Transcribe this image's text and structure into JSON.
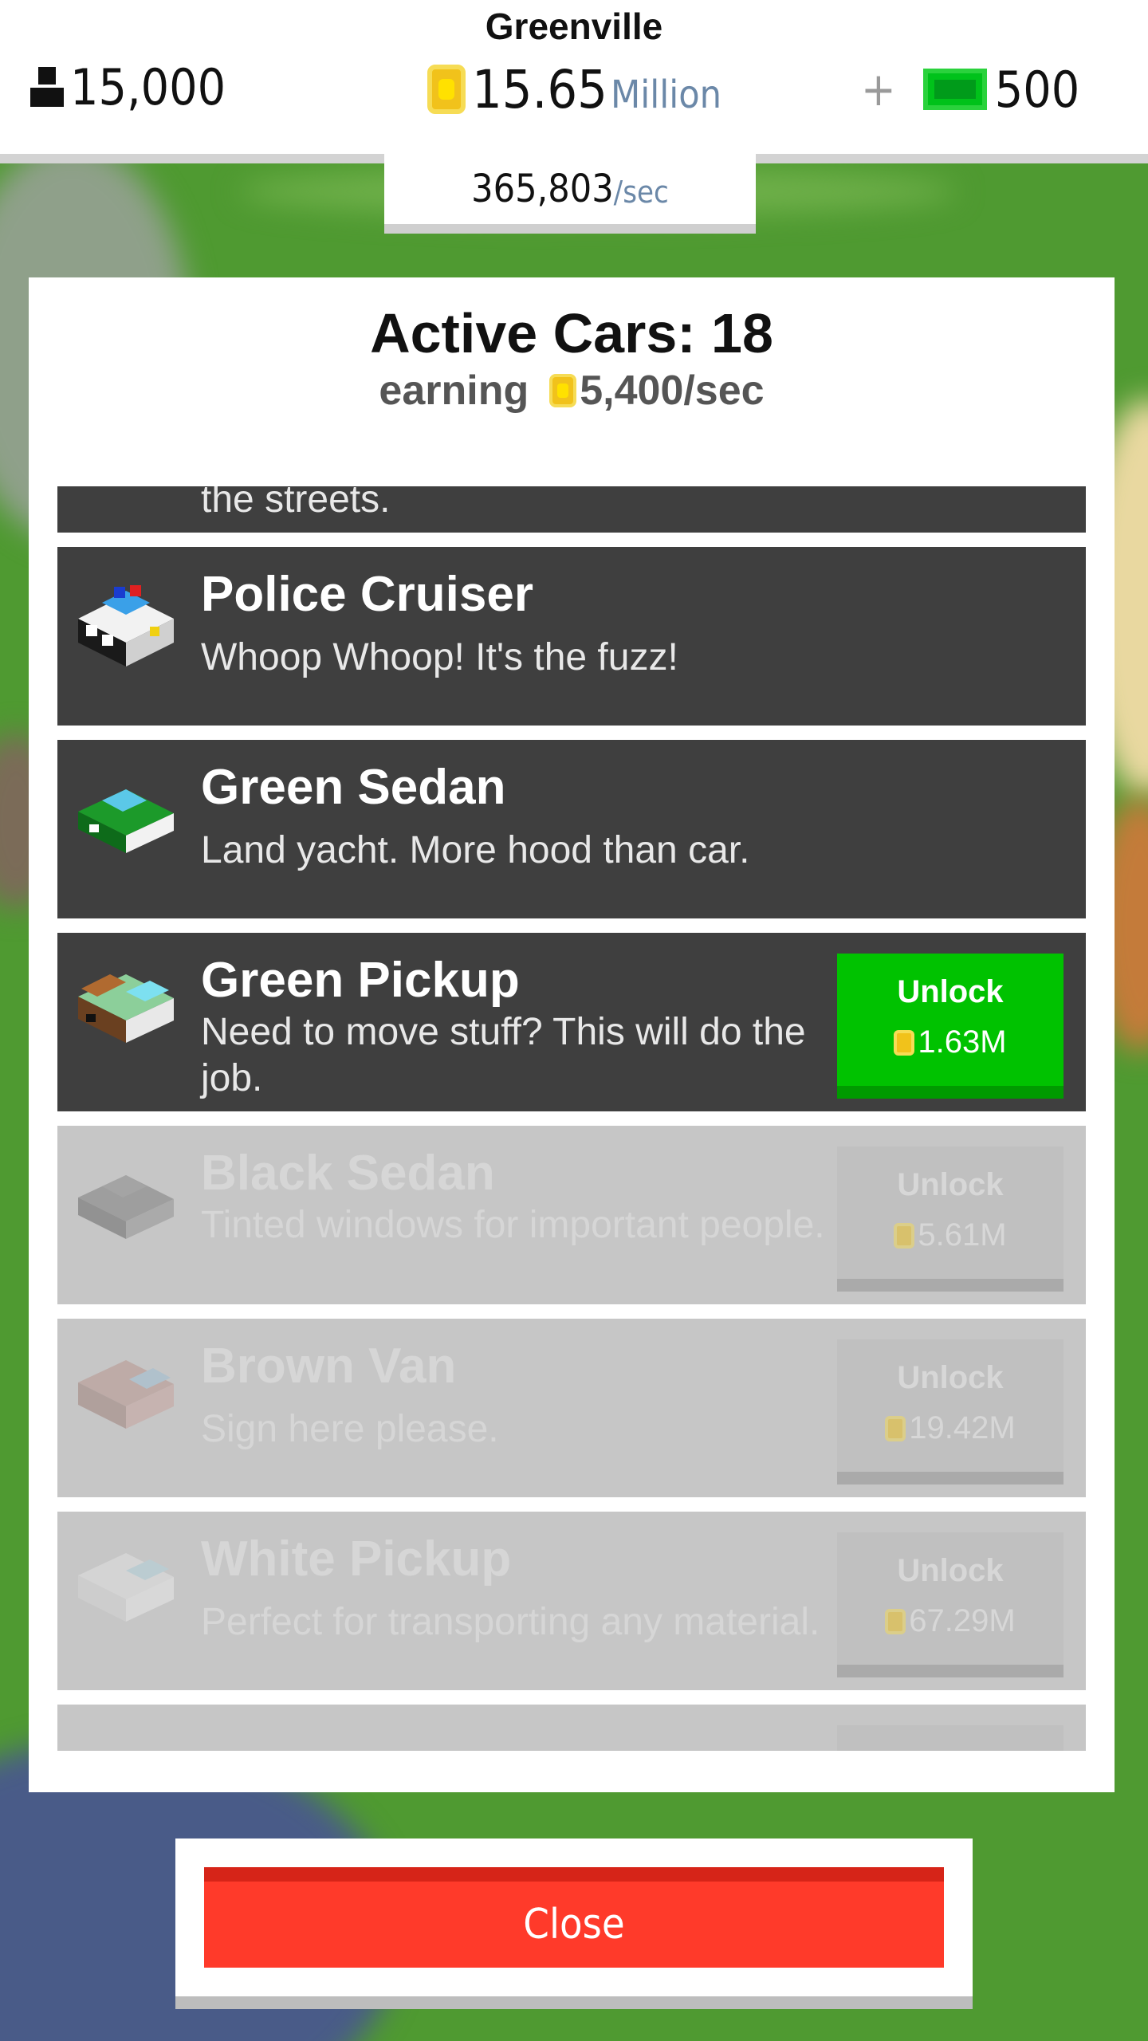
{
  "header": {
    "city": "Greenville",
    "population": "15,000",
    "money_value": "15.65",
    "money_unit": "Million",
    "gems_plus": "+",
    "gems": "500",
    "rate_value": "365,803",
    "rate_unit": "/sec"
  },
  "panel": {
    "title": "Active Cars: 18",
    "earning_label": "earning",
    "earning_value": "5,400/sec"
  },
  "cars": [
    {
      "name": "",
      "desc": "the streets.",
      "locked": false
    },
    {
      "name": "Police Cruiser",
      "desc": "Whoop Whoop! It's the fuzz!",
      "locked": false,
      "icon": "police-cruiser-icon"
    },
    {
      "name": "Green Sedan",
      "desc": "Land yacht. More hood than car.",
      "locked": false,
      "icon": "green-sedan-icon"
    },
    {
      "name": "Green Pickup",
      "desc": "Need to move stuff? This will do the job.",
      "locked": false,
      "icon": "green-pickup-icon",
      "unlock_label": "Unlock",
      "price": "1.63M"
    },
    {
      "name": "Black Sedan",
      "desc": "Tinted windows for important people.",
      "locked": true,
      "icon": "black-sedan-icon",
      "unlock_label": "Unlock",
      "price": "5.61M"
    },
    {
      "name": "Brown Van",
      "desc": "Sign here please.",
      "locked": true,
      "icon": "brown-van-icon",
      "unlock_label": "Unlock",
      "price": "19.42M"
    },
    {
      "name": "White Pickup",
      "desc": "Perfect for transporting any material.",
      "locked": true,
      "icon": "white-pickup-icon",
      "unlock_label": "Unlock",
      "price": "67.29M"
    }
  ],
  "close_label": "Close",
  "colors": {
    "accent_green": "#00c200",
    "close_red": "#ff3a2a",
    "row_dark": "#3f3f3f",
    "row_locked": "#c6c6c6"
  }
}
